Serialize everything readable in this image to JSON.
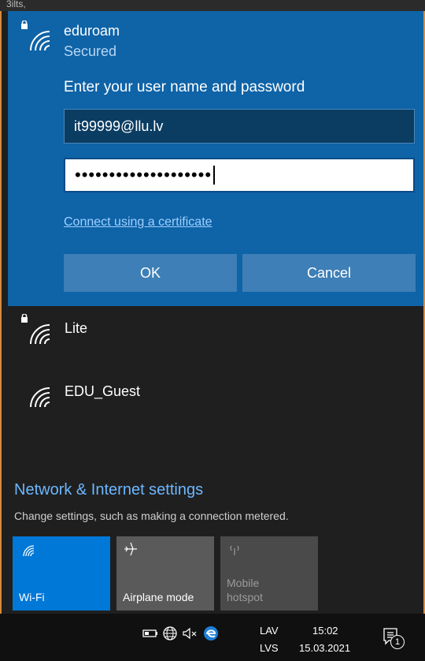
{
  "top_strip": {
    "text": "3ilts,"
  },
  "expanded": {
    "network_name": "eduroam",
    "status": "Secured",
    "prompt": "Enter your user name and password",
    "username_value": "it99999@llu.lv",
    "password_mask": "••••••••••••••••••••",
    "cert_link": "Connect using a certificate",
    "ok_label": "OK",
    "cancel_label": "Cancel"
  },
  "networks": [
    {
      "name": "Lite",
      "secured": true
    },
    {
      "name": "EDU_Guest",
      "secured": false
    }
  ],
  "settings": {
    "title": "Network & Internet settings",
    "subtitle": "Change settings, such as making a connection metered."
  },
  "tiles": {
    "wifi": "Wi-Fi",
    "airplane": "Airplane mode",
    "hotspot_line1": "Mobile",
    "hotspot_line2": "hotspot"
  },
  "taskbar": {
    "lang_top": "LAV",
    "lang_bottom": "LVS",
    "time": "15:02",
    "date": "15.03.2021",
    "notification_count": "1"
  },
  "colors": {
    "accent": "#0078d7",
    "panel_blue": "#0f63a7",
    "link": "#6cb7ff"
  },
  "icons": [
    "wifi-secured-icon",
    "wifi-icon",
    "airplane-icon",
    "hotspot-icon",
    "battery-icon",
    "globe-icon",
    "volume-muted-icon",
    "edge-icon",
    "notification-icon"
  ]
}
